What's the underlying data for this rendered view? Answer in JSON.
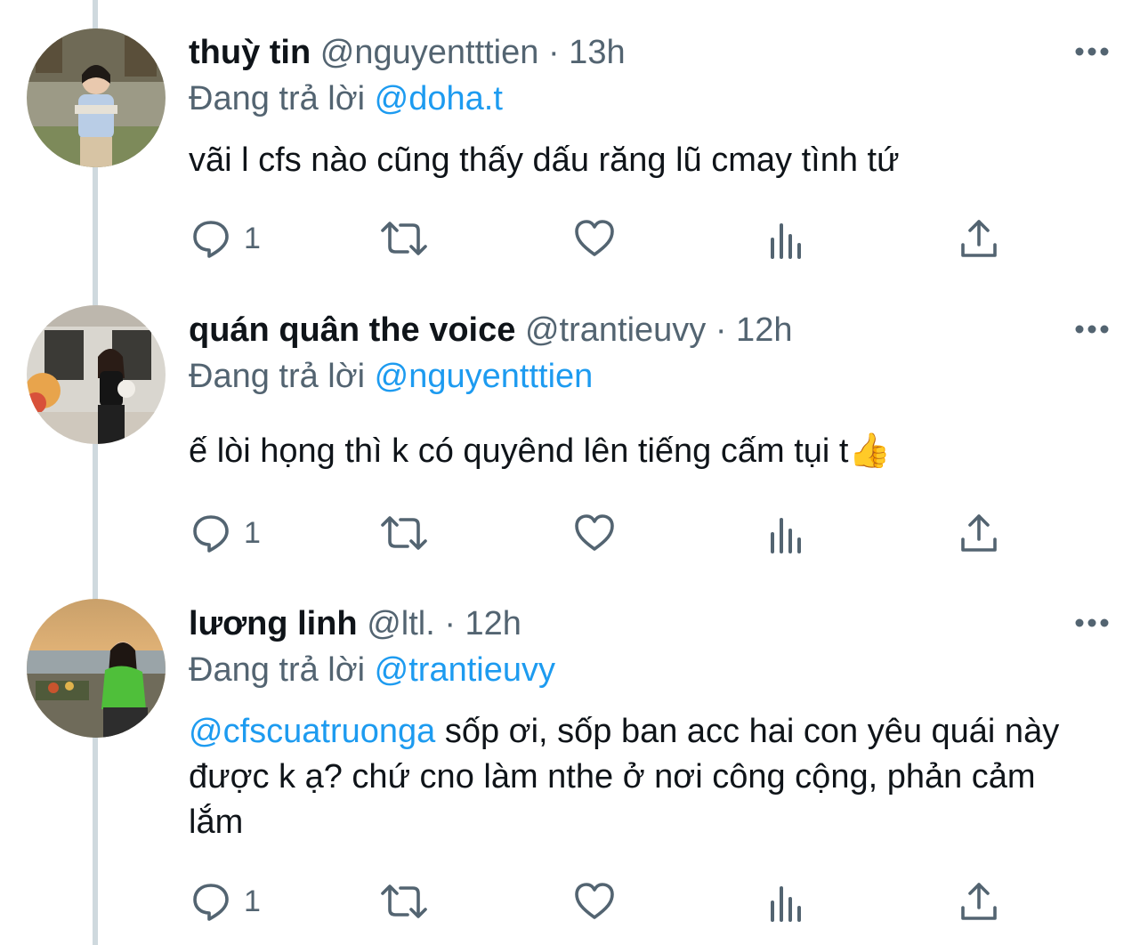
{
  "colors": {
    "accent": "#1d9bf0",
    "muted": "#536471",
    "text": "#0f1419",
    "thread_line": "#cfd9de"
  },
  "icons": {
    "more": "more-options-icon",
    "reply": "reply-icon",
    "retweet": "retweet-icon",
    "like": "like-icon",
    "views": "views-icon",
    "share": "share-icon"
  },
  "tweets": [
    {
      "name": "thuỳ tin",
      "handle": "@nguyentttien",
      "time": "· 13h",
      "reply_label": "Đang trả lời",
      "reply_to": "@doha.t",
      "mention": "",
      "text": "vãi l cfs nào cũng thấy dấu răng lũ cmay tình tứ",
      "reply_count": "1"
    },
    {
      "name": "quán quân the voice",
      "handle": "@trantieuvy",
      "time": "· 12h",
      "reply_label": "Đang trả lời",
      "reply_to": "@nguyentttien",
      "mention": "",
      "text": "ế lòi họng thì k có quyênd lên tiếng cấm tụi t👍",
      "reply_count": "1"
    },
    {
      "name": "lương linh",
      "handle": "@ltl.",
      "time": "· 12h",
      "reply_label": "Đang trả lời",
      "reply_to": "@trantieuvy",
      "mention": "@cfscuatruonga",
      "text": " sốp ơi, sốp ban acc hai con yêu quái này được k ạ? chứ cno làm nthe ở nơi công cộng, phản cảm lắm",
      "reply_count": "1"
    }
  ]
}
